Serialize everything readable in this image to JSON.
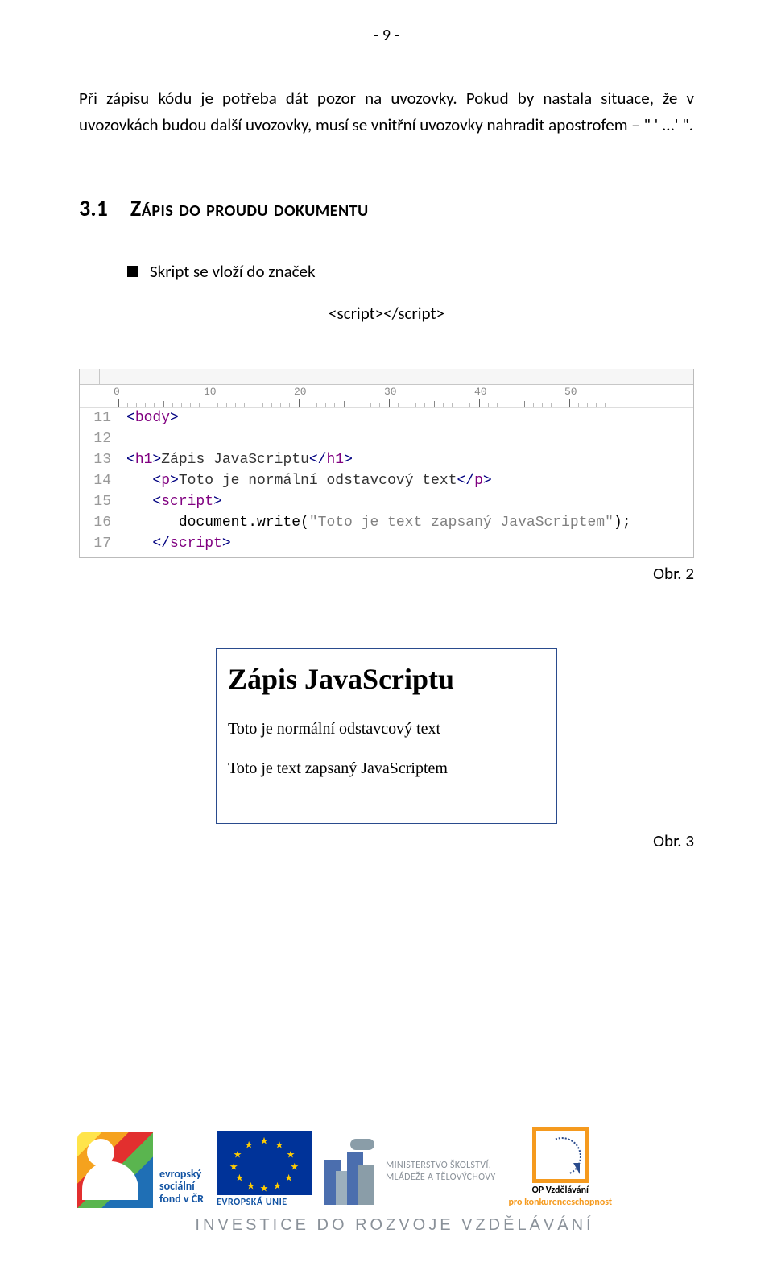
{
  "page_number": "- 9 -",
  "paragraph": "Při zápisu kódu je potřeba dát pozor na uvozovky. Pokud by nastala situace, že v uvozovkách budou další uvozovky, musí se vnitřní uvozovky nahradit apostrofem – \" ' ...' \".",
  "section": {
    "number": "3.1",
    "title": "Zápis do proudu dokumentu"
  },
  "bullet": "Skript se vloží do značek",
  "snippet": "<script></script>",
  "editor": {
    "ruler": [
      "0",
      "10",
      "20",
      "30",
      "40",
      "50"
    ],
    "gutter": [
      "11",
      "12",
      "13",
      "14",
      "15",
      "16",
      "17"
    ],
    "code": {
      "l11": {
        "open": "<",
        "tag": "body",
        "close": ">"
      },
      "l13": {
        "o1": "<",
        "t1": "h1",
        "c1": ">",
        "txt": "Zápis JavaScriptu",
        "o2": "</",
        "t2": "h1",
        "c2": ">"
      },
      "l14": {
        "indent": "   ",
        "o1": "<",
        "t1": "p",
        "c1": ">",
        "txt": "Toto je normální odstavcový text",
        "o2": "</",
        "t2": "p",
        "c2": ">"
      },
      "l15": {
        "indent": "   ",
        "o1": "<",
        "t1": "script",
        "c1": ">"
      },
      "l16": {
        "indent": "      ",
        "fn": "document.write(",
        "str": "\"Toto je text zapsaný JavaScriptem\"",
        "end": ");"
      },
      "l17": {
        "indent": "   ",
        "o1": "</",
        "t1": "script",
        "c1": ">"
      }
    }
  },
  "fig2_caption": "Obr. 2",
  "output": {
    "heading": "Zápis JavaScriptu",
    "p1": "Toto je normální odstavcový text",
    "p2": "Toto je text zapsaný JavaScriptem"
  },
  "fig3_caption": "Obr. 3",
  "footer": {
    "esf": {
      "l1": "evropský",
      "l2": "sociální",
      "l3": "fond v ČR"
    },
    "eu": "EVROPSKÁ UNIE",
    "msmt": {
      "l1": "MINISTERSTVO ŠKOLSTVÍ,",
      "l2": "MLÁDEŽE A TĚLOVÝCHOVY"
    },
    "opvk": {
      "l1": "OP Vzdělávání",
      "l2": "pro konkurenceschopnost"
    },
    "invest": "INVESTICE DO ROZVOJE VZDĚLÁVÁNÍ"
  }
}
